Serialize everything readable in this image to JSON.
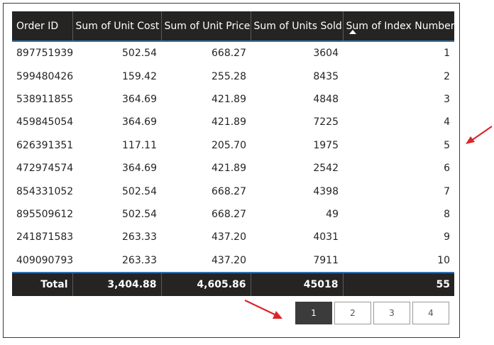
{
  "table": {
    "columns": [
      "Order ID",
      "Sum of Unit Cost",
      "Sum of Unit Price",
      "Sum of Units Sold",
      "Sum of Index Number"
    ],
    "rows": [
      [
        "897751939",
        "502.54",
        "668.27",
        "3604",
        "1"
      ],
      [
        "599480426",
        "159.42",
        "255.28",
        "8435",
        "2"
      ],
      [
        "538911855",
        "364.69",
        "421.89",
        "4848",
        "3"
      ],
      [
        "459845054",
        "364.69",
        "421.89",
        "7225",
        "4"
      ],
      [
        "626391351",
        "117.11",
        "205.70",
        "1975",
        "5"
      ],
      [
        "472974574",
        "364.69",
        "421.89",
        "2542",
        "6"
      ],
      [
        "854331052",
        "502.54",
        "668.27",
        "4398",
        "7"
      ],
      [
        "895509612",
        "502.54",
        "668.27",
        "49",
        "8"
      ],
      [
        "241871583",
        "263.33",
        "437.20",
        "4031",
        "9"
      ],
      [
        "409090793",
        "263.33",
        "437.20",
        "7911",
        "10"
      ]
    ],
    "total": [
      "Total",
      "3,404.88",
      "4,605.86",
      "45018",
      "55"
    ]
  },
  "pagination": {
    "pages": [
      "1",
      "2",
      "3",
      "4"
    ],
    "current": "1"
  },
  "colors": {
    "header_bg": "#252423",
    "accent_line": "#2f6fb3",
    "annotation_arrow": "#d9262b"
  }
}
